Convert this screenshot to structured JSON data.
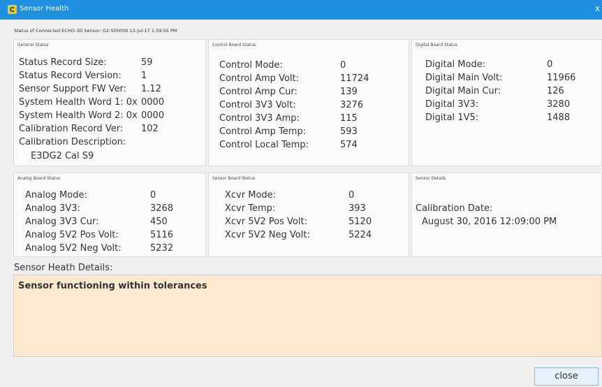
{
  "window": {
    "title": "Sensor Health",
    "close_glyph": "x",
    "icon": "app-icon"
  },
  "status_line": "Status of Connected ECHO-3D Sensor: G2-S00009  13-Jul-17 1:59:55 PM",
  "general": {
    "title": "General Status",
    "rows": [
      {
        "label": "Status Record Size:",
        "value": "59"
      },
      {
        "label": "Status Record Version:",
        "value": "1"
      },
      {
        "label": "Sensor Support FW Ver:",
        "value": "1.12"
      },
      {
        "label": "System Health Word 1: 0x",
        "value": "0000"
      },
      {
        "label": "System Health Word 2: 0x",
        "value": "0000"
      },
      {
        "label": "Calibration Record Ver:",
        "value": "102"
      }
    ],
    "cal_desc_label": "Calibration Description:",
    "cal_desc_value": "E3DG2 Cal S9"
  },
  "control": {
    "title": "Control Board Status",
    "rows": [
      {
        "label": "Control Mode:",
        "value": "0"
      },
      {
        "label": "Control Amp Volt:",
        "value": "11724"
      },
      {
        "label": "Control Amp Cur:",
        "value": "139"
      },
      {
        "label": "Control 3V3 Volt:",
        "value": "3276"
      },
      {
        "label": "Control 3V3 Amp:",
        "value": "115"
      },
      {
        "label": "Control Amp Temp:",
        "value": "593"
      },
      {
        "label": "Control Local Temp:",
        "value": "574"
      }
    ]
  },
  "digital": {
    "title": "Digital Board Status",
    "rows": [
      {
        "label": "Digital Mode:",
        "value": "0"
      },
      {
        "label": "Digital Main Volt:",
        "value": "11966"
      },
      {
        "label": "Digital Main Cur:",
        "value": "126"
      },
      {
        "label": "Digital 3V3:",
        "value": "3280"
      },
      {
        "label": "Digital 1V5:",
        "value": "1488"
      }
    ]
  },
  "analog": {
    "title": "Analog Board Status",
    "rows": [
      {
        "label": "Analog Mode:",
        "value": "0"
      },
      {
        "label": "Analog 3V3:",
        "value": "3268"
      },
      {
        "label": "Analog 3V3 Cur:",
        "value": "450"
      },
      {
        "label": "Analog 5V2 Pos Volt:",
        "value": "5116"
      },
      {
        "label": "Analog 5V2 Neg Volt:",
        "value": "5232"
      }
    ]
  },
  "sensor_board": {
    "title": "Sensor Board Status",
    "rows": [
      {
        "label": "Xcvr Mode:",
        "value": "0"
      },
      {
        "label": "Xcvr Temp:",
        "value": "393"
      },
      {
        "label": "Xcvr 5V2 Pos Volt:",
        "value": "5120"
      },
      {
        "label": "Xcvr 5V2 Neg Volt:",
        "value": "5224"
      }
    ]
  },
  "sensor_details": {
    "title": "Sensor Details",
    "cal_date_label": "Calibration Date:",
    "cal_date_value": "August 30, 2016 12:09:00 PM"
  },
  "health_details": {
    "label": "Sensor Heath Details:",
    "text": "Sensor functioning within tolerances"
  },
  "close_button_label": "close",
  "colors": {
    "titlebar": "#1e90df",
    "details_bg": "#fde9cf",
    "button_bg": "#e5f1fb"
  }
}
